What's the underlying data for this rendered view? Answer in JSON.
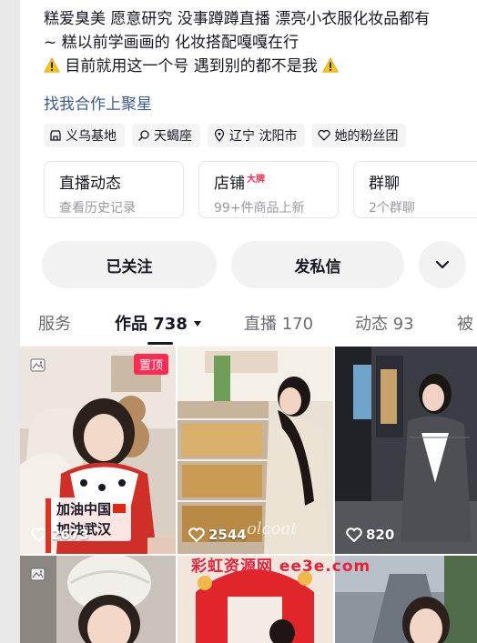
{
  "bio": {
    "line1": "糕爱臭美 愿意研究 没事蹲蹲直播 漂亮小衣服化妆品都有",
    "line2": "~ 糕以前学画画的 化妆搭配嘎嘎在行",
    "line3": "目前就用这一个号 遇到别的都不是我",
    "link": "找我合作上聚星"
  },
  "tags": [
    {
      "icon": "store-icon",
      "label": "义乌基地"
    },
    {
      "icon": "search-person-icon",
      "label": "天蝎座"
    },
    {
      "icon": "location-icon",
      "label": "辽宁 沈阳市"
    },
    {
      "icon": "fan-club-icon",
      "label": "她的粉丝团"
    }
  ],
  "cards": [
    {
      "title": "直播动态",
      "sub": "查看历史记录",
      "badge": ""
    },
    {
      "title": "店铺",
      "sub": "99+件商品上新",
      "badge": "大牌"
    },
    {
      "title": "群聊",
      "sub": "2个群聊",
      "badge": ""
    }
  ],
  "buttons": {
    "follow": "已关注",
    "message": "发私信",
    "more_icon": "chevron-down-icon"
  },
  "tabs": [
    {
      "label": "服务"
    },
    {
      "label": "作品 738"
    },
    {
      "label": "直播 170"
    },
    {
      "label": "动态 93"
    },
    {
      "label": "被"
    }
  ],
  "videos": [
    {
      "likes": "2673",
      "badge": "置顶",
      "caption_1": "加油中国",
      "caption_2": "加油武汉"
    },
    {
      "likes": "2544",
      "badge": "",
      "overlay": "olcoat"
    },
    {
      "likes": "820",
      "badge": ""
    },
    {
      "likes": "",
      "badge": ""
    },
    {
      "likes": "",
      "badge": ""
    },
    {
      "likes": "",
      "badge": ""
    }
  ],
  "watermark": "彩虹资源网 ee3e.com",
  "colors": {
    "accent_red": "#fe2c55",
    "link_blue": "#3e5b8c",
    "text_primary": "#161823",
    "text_secondary": "#9a9aa1",
    "button_bg": "#f2f2f3"
  }
}
